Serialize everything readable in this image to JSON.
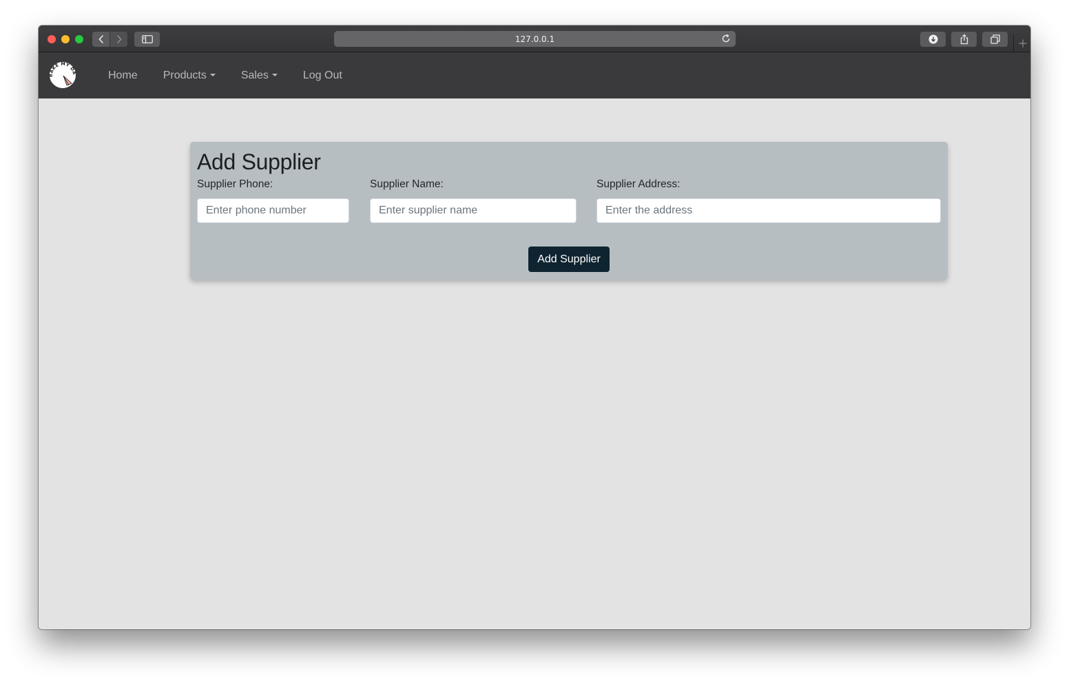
{
  "browser": {
    "url": "127.0.0.1"
  },
  "navbar": {
    "logo_text": "BAKE MY DAY",
    "items": [
      {
        "label": "Home",
        "has_dropdown": false
      },
      {
        "label": "Products",
        "has_dropdown": true
      },
      {
        "label": "Sales",
        "has_dropdown": true
      },
      {
        "label": "Log Out",
        "has_dropdown": false
      }
    ]
  },
  "form": {
    "title": "Add Supplier",
    "phone": {
      "label": "Supplier Phone:",
      "placeholder": "Enter phone number",
      "value": ""
    },
    "name": {
      "label": "Supplier Name:",
      "placeholder": "Enter supplier name",
      "value": ""
    },
    "address": {
      "label": "Supplier Address:",
      "placeholder": "Enter the address",
      "value": ""
    },
    "submit_label": "Add Supplier"
  },
  "colors": {
    "navbar_bg": "#3a3a3c",
    "page_bg": "#e3e3e3",
    "card_bg": "#b7bec2",
    "button_bg": "#0e2430"
  }
}
